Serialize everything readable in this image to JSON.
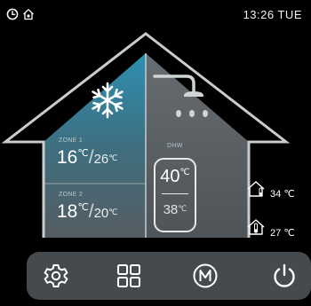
{
  "status_bar": {
    "icons": [
      "clock-icon",
      "house-icon"
    ],
    "clock": "13:26 TUE"
  },
  "zone1": {
    "label": "ZONE 1",
    "set_temp": "16",
    "actual_temp": "26",
    "set_unit": "℃",
    "actual_unit": "℃",
    "separator": "/"
  },
  "zone2": {
    "label": "ZONE 2",
    "set_temp": "18",
    "actual_temp": "20",
    "set_unit": "℃",
    "actual_unit": "℃",
    "separator": "/"
  },
  "dhw": {
    "label": "DHW",
    "set_temp": "40",
    "actual_temp": "38",
    "set_unit": "℃",
    "actual_unit": "℃"
  },
  "indoor": {
    "value": "34",
    "unit": "℃",
    "icon": "indoor-temperature-icon"
  },
  "outdoor": {
    "value": "27",
    "unit": "℃",
    "icon": "outdoor-temperature-icon"
  },
  "mode": {
    "icon": "snowflake-icon"
  },
  "nav": {
    "buttons": [
      "settings-icon",
      "menu-grid-icon",
      "manual-mode-icon",
      "power-icon"
    ]
  },
  "colors": {
    "cool_panel_top": "#2e8fb0",
    "cool_panel_bottom": "#5a6268",
    "house_outline": "#c9cccd",
    "nav_background": "#444a4e",
    "background": "#000000"
  }
}
